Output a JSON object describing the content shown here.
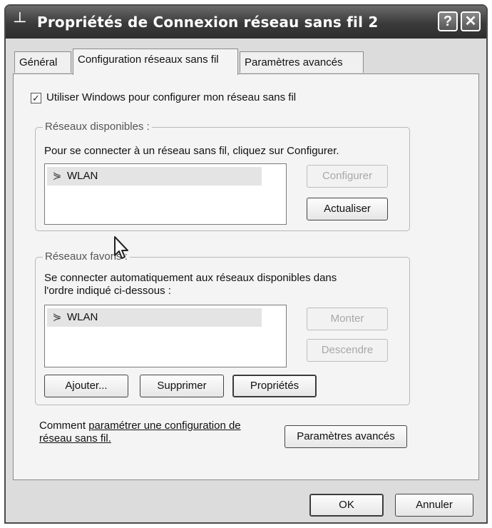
{
  "window": {
    "title": "Propriétés de Connexion réseau sans fil 2",
    "help_label": "?",
    "close_label": "✕"
  },
  "tabs": [
    {
      "label": "Général",
      "active": false
    },
    {
      "label": "Configuration réseaux sans fil",
      "active": true
    },
    {
      "label": "Paramètres avancés",
      "active": false
    }
  ],
  "use_windows": {
    "label": "Utiliser Windows pour configurer mon réseau sans fil",
    "checked": true
  },
  "available": {
    "legend": "Réseaux disponibles :",
    "description": "Pour se connecter à un réseau sans fil, cliquez sur Configurer.",
    "networks": [
      "WLAN"
    ],
    "configure_label": "Configurer",
    "refresh_label": "Actualiser"
  },
  "preferred": {
    "legend": "Réseaux favoris :",
    "description_line1": "Se connecter automatiquement aux réseaux disponibles dans",
    "description_line2": "l'ordre indiqué ci-dessous :",
    "networks": [
      "WLAN"
    ],
    "up_label": "Monter",
    "down_label": "Descendre",
    "add_label": "Ajouter...",
    "remove_label": "Supprimer",
    "properties_label": "Propriétés"
  },
  "help": {
    "prefix": "Comment ",
    "link_line1": "paramétrer une configuration de",
    "link_line2": "réseau sans fil."
  },
  "advanced_button_label": "Paramètres avancés",
  "footer": {
    "ok_label": "OK",
    "cancel_label": "Annuler"
  }
}
